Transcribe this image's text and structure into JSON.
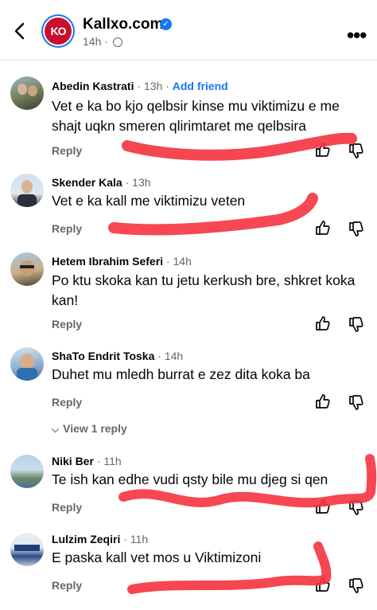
{
  "header": {
    "page_name": "Kallxo.com",
    "logo_text": "KO",
    "time": "14h",
    "verified_glyph": "✓",
    "globe_icon": "globe-icon",
    "more_glyph": "•••"
  },
  "comments": [
    {
      "author": "Abedin Kastrati",
      "time": "13h",
      "extra": "Add friend",
      "text": "Vet e ka bo kjo qelbsir kinse mu viktimizu e me shajt uqkn smeren qlirimtaret me qelbsira",
      "reply": "Reply"
    },
    {
      "author": "Skender Kala",
      "time": "13h",
      "text": "Vet e ka kall me viktimizu veten",
      "reply": "Reply"
    },
    {
      "author": "Hetem Ibrahim Seferi",
      "time": "14h",
      "text": "Po ktu skoka kan tu jetu kerkush bre, shkret koka kan!",
      "reply": "Reply"
    },
    {
      "author": "ShaTo Endrit Toska",
      "time": "14h",
      "text": "Duhet mu mledh burrat e zez dita koka ba",
      "reply": "Reply",
      "view_replies": "View 1 reply"
    },
    {
      "author": "Niki Ber",
      "time": "11h",
      "text": "Te ish kan edhe vudi qsty bile mu djeg si qen",
      "reply": "Reply"
    },
    {
      "author": "Lulzim Zeqiri",
      "time": "11h",
      "text": "E paska kall vet mos u Viktimizoni",
      "reply": "Reply"
    }
  ],
  "colors": {
    "accent": "#1877f2",
    "brand": "#c8102e",
    "scribble": "#f5333f"
  }
}
